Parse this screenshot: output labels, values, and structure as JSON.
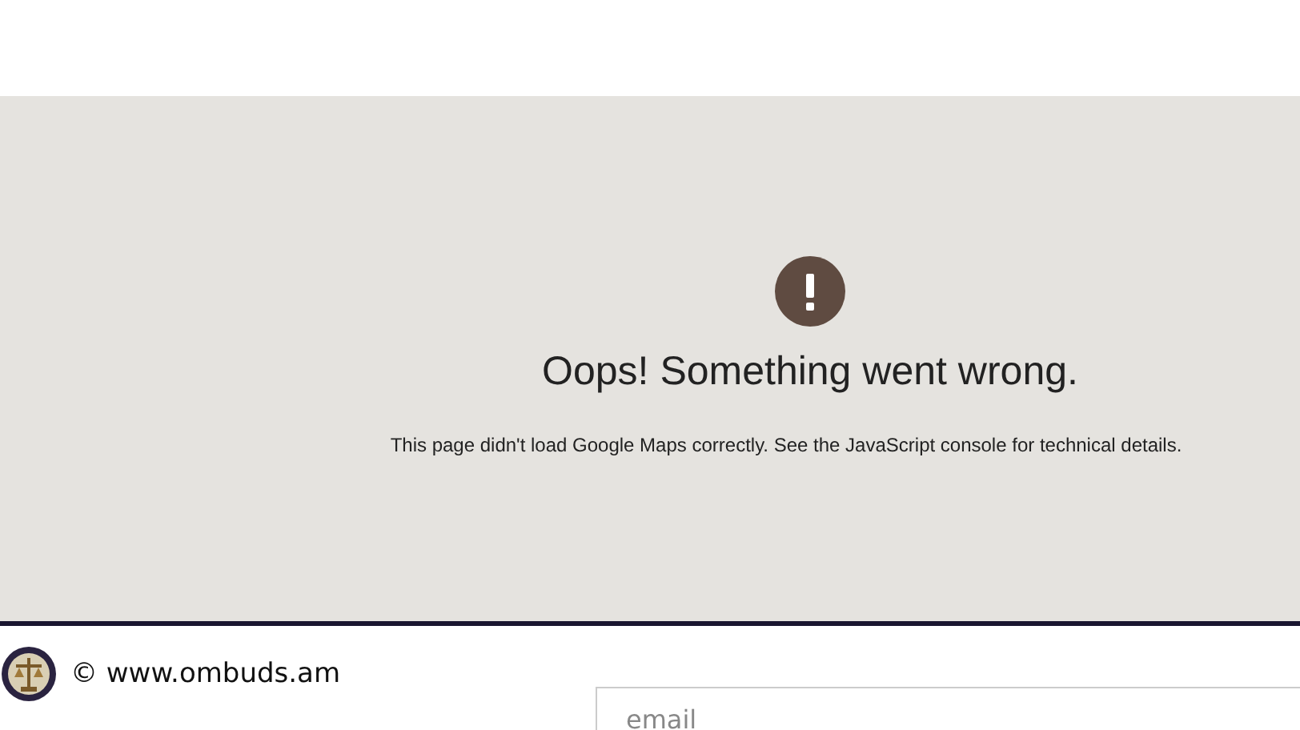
{
  "map_error": {
    "title": "Oops! Something went wrong.",
    "message": "This page didn't load Google Maps correctly. See the JavaScript console for technical details."
  },
  "footer": {
    "copyright": "© www.ombuds.am",
    "email_field": {
      "placeholder": "email"
    }
  }
}
